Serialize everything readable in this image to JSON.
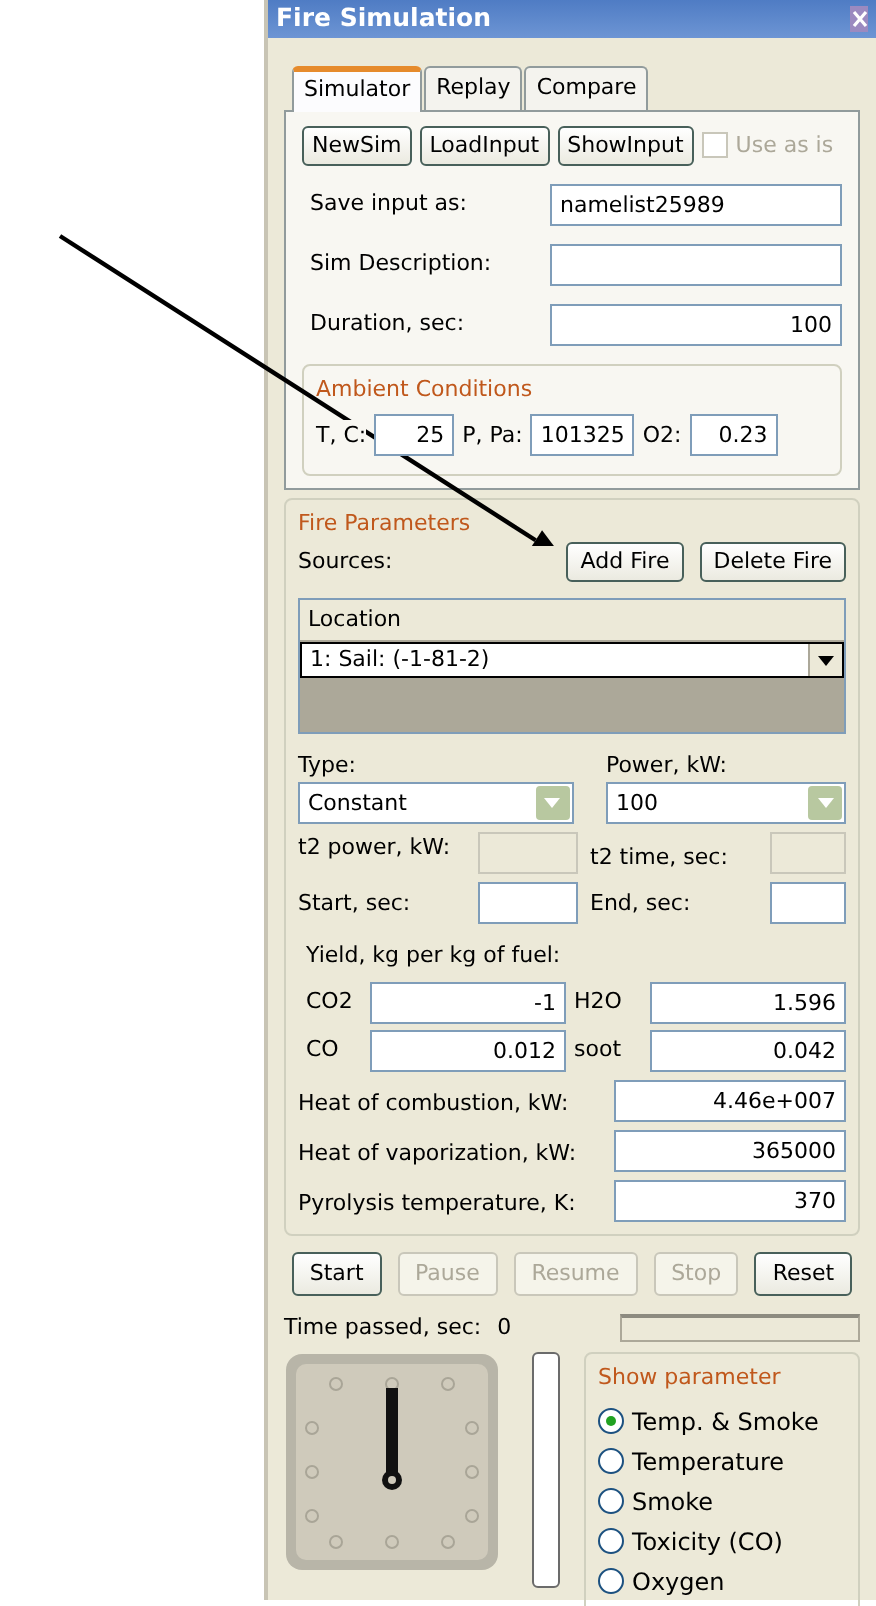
{
  "window": {
    "title": "Fire Simulation"
  },
  "tabs": [
    {
      "label": "Simulator",
      "selected": true
    },
    {
      "label": "Replay",
      "selected": false
    },
    {
      "label": "Compare",
      "selected": false
    }
  ],
  "top_buttons": [
    "NewSim",
    "LoadInput",
    "ShowInput"
  ],
  "use_as_is": {
    "label": "Use as is",
    "checked": false,
    "disabled": true
  },
  "fields": [
    {
      "label": "Save input as:",
      "value": "namelist25989",
      "kind": "text"
    },
    {
      "label": "Sim Description:",
      "kind": "text"
    },
    {
      "label": "Duration, sec:",
      "value": "100",
      "kind": "number"
    }
  ],
  "ambient": {
    "title": "Ambient Conditions",
    "fields": [
      {
        "label": "T, C:",
        "value": "25"
      },
      {
        "label": "P, Pa:",
        "value": "101325"
      },
      {
        "label": "O2:",
        "value": "0.23"
      }
    ]
  },
  "fire": {
    "title": "Fire Parameters",
    "sources_label": "Sources:",
    "buttons": [
      "Add Fire",
      "Delete Fire"
    ],
    "location": {
      "header": "Location",
      "value": "1: Sail: (-1-81-2)"
    },
    "type": {
      "label": "Type:",
      "value": "Constant"
    },
    "power": {
      "label": "Power, kW:",
      "value": "100"
    },
    "timing": [
      {
        "label": "t2 power, kW:",
        "disabled": true
      },
      {
        "label": "t2 time, sec:",
        "disabled": true
      },
      {
        "label": "Start, sec:",
        "disabled": false
      },
      {
        "label": "End, sec:",
        "disabled": false
      }
    ],
    "yield_label": "Yield, kg per kg of fuel:",
    "yields": [
      {
        "label": "CO2",
        "value": "-1"
      },
      {
        "label": "H2O",
        "value": "1.596"
      },
      {
        "label": "CO",
        "value": "0.012"
      },
      {
        "label": "soot",
        "value": "0.042"
      }
    ],
    "heats": [
      {
        "label": "Heat of combustion, kW:",
        "value": "4.46e+007"
      },
      {
        "label": "Heat of vaporization, kW:",
        "value": "365000"
      },
      {
        "label": "Pyrolysis temperature, K:",
        "value": "370"
      }
    ]
  },
  "controls": [
    {
      "label": "Start",
      "disabled": false
    },
    {
      "label": "Pause",
      "disabled": true
    },
    {
      "label": "Resume",
      "disabled": true
    },
    {
      "label": "Stop",
      "disabled": true
    },
    {
      "label": "Reset",
      "disabled": false
    }
  ],
  "progress": {
    "level": 0
  },
  "time": {
    "label": "Time passed, sec:",
    "value": "0"
  },
  "meter": {
    "level": 0
  },
  "show_parameter": {
    "title": "Show parameter",
    "options": [
      {
        "label": "Temp. & Smoke",
        "selected": true
      },
      {
        "label": "Temperature",
        "selected": false
      },
      {
        "label": "Smoke",
        "selected": false
      },
      {
        "label": "Toxicity (CO)",
        "selected": false
      },
      {
        "label": "Oxygen",
        "selected": false
      }
    ]
  }
}
